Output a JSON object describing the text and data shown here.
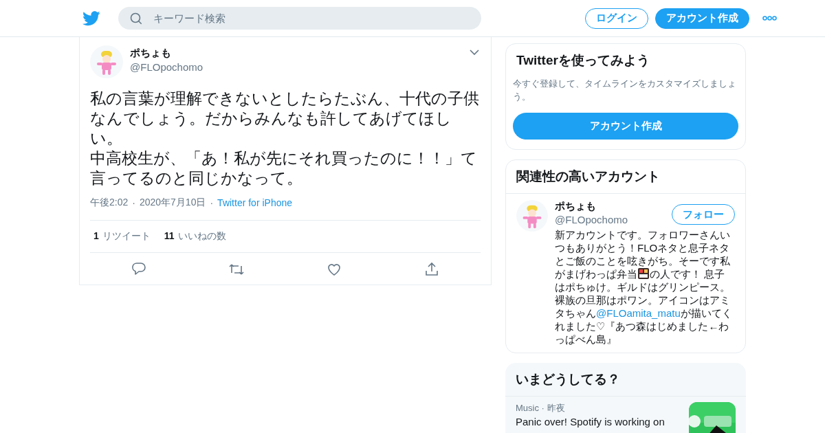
{
  "header": {
    "search": {
      "placeholder": "キーワード検索"
    },
    "buttons": [
      {
        "label": "ログイン",
        "kind": "outline"
      },
      {
        "label": "アカウント作成",
        "kind": "filled"
      }
    ]
  },
  "tweet": {
    "name": "ポちょも",
    "handle": "@FLOpochomo",
    "paragraphs": [
      "私の言葉が理解できないとしたらたぶん、十代の子供なんでしょう。だからみんなも許してあげてほしい。",
      "中高校生が、「あ！私が先にそれ買ったのに！！」て言ってるのと同じかなって。"
    ],
    "time": "午後2:02",
    "separator": "·",
    "date": "2020年7月10日",
    "source": "Twitter for iPhone",
    "stats": [
      {
        "count": "1",
        "label": "リツイート"
      },
      {
        "count": "11",
        "label": "いいねの数"
      }
    ],
    "actions": [
      {
        "kind": "reply"
      },
      {
        "kind": "retweet"
      },
      {
        "kind": "like"
      },
      {
        "kind": "share"
      }
    ]
  },
  "signup_card": {
    "title": "Twitterを使ってみよう",
    "text": "今すぐ登録して、タイムラインをカスタマイズしましょう。",
    "button": "アカウント作成"
  },
  "related_card": {
    "title": "関連性の高いアカウント",
    "accounts": [
      {
        "name": "ポちょも",
        "handle": "@FLOpochomo",
        "button": "フォロー",
        "bio": [
          {
            "kind": "text",
            "text": "新アカウントです。フォロワーさんいつもありがとう！FLOネタと息子ネタとご飯のことを呟きがち。そーです私がまげわっぱ弁当"
          },
          {
            "kind": "icon"
          },
          {
            "kind": "text",
            "text": "の人です！ 息子はポちゅけ。ギルドはグリンピース。裸族の旦那はポワン。アイコンはアミタちゃん"
          },
          {
            "kind": "mention",
            "text": "@FLOamita_matu"
          },
          {
            "kind": "text",
            "text": "が描いてくれました♡『あつ森はじめました←わっぱべん島』"
          }
        ]
      }
    ]
  },
  "trends_card": {
    "title": "いまどうしてる？",
    "items": [
      {
        "category": "Music",
        "separator": "·",
        "time": "昨夜",
        "headline": "Panic over! Spotify is working on"
      }
    ]
  }
}
